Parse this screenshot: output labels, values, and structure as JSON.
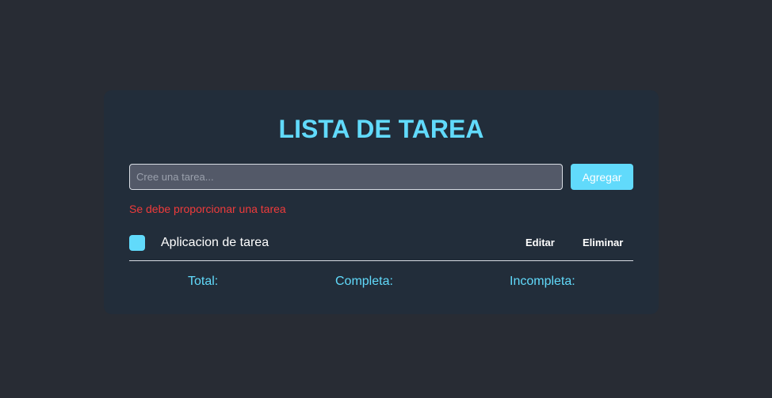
{
  "app": {
    "title": "LISTA DE TAREA"
  },
  "form": {
    "placeholder": "Cree una tarea...",
    "value": "",
    "add_label": "Agregar",
    "error": "Se debe proporcionar una tarea"
  },
  "tasks": [
    {
      "text": "Aplicacion de tarea",
      "checked": false,
      "edit_label": "Editar",
      "delete_label": "Eliminar"
    }
  ],
  "stats": {
    "total_label": "Total:",
    "complete_label": "Completa:",
    "incomplete_label": "Incompleta:"
  },
  "colors": {
    "background": "#282c34",
    "card": "#222d3a",
    "accent": "#61dafb",
    "error": "#ef3b3b",
    "input_bg": "#535968"
  }
}
